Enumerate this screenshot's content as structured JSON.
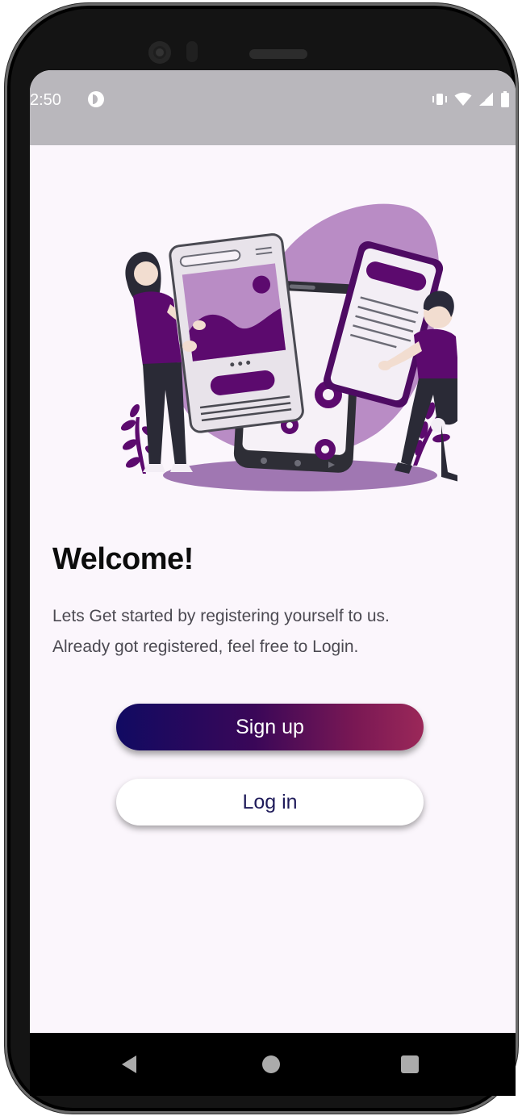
{
  "status_bar": {
    "time": "2:50",
    "icons": [
      "app-notification-icon",
      "vibrate-icon",
      "wifi-icon",
      "signal-icon",
      "battery-icon"
    ]
  },
  "illustration": {
    "icon": "onboarding-illustration-icon"
  },
  "welcome": {
    "title": "Welcome!",
    "line1": "Lets Get started by registering yourself to us.",
    "line2": "Already got registered, feel free to Login."
  },
  "buttons": {
    "signup_label": "Sign up",
    "login_label": "Log in"
  },
  "nav": {
    "icons": [
      "back-icon",
      "home-icon",
      "recents-icon"
    ]
  },
  "colors": {
    "accent_purple": "#5c0a6e",
    "signup_gradient_start": "#110a62",
    "signup_gradient_end": "#9b2859",
    "login_text": "#1f1b5a",
    "screen_background": "#fbf6fc",
    "status_bar": "#b9b7bc"
  }
}
